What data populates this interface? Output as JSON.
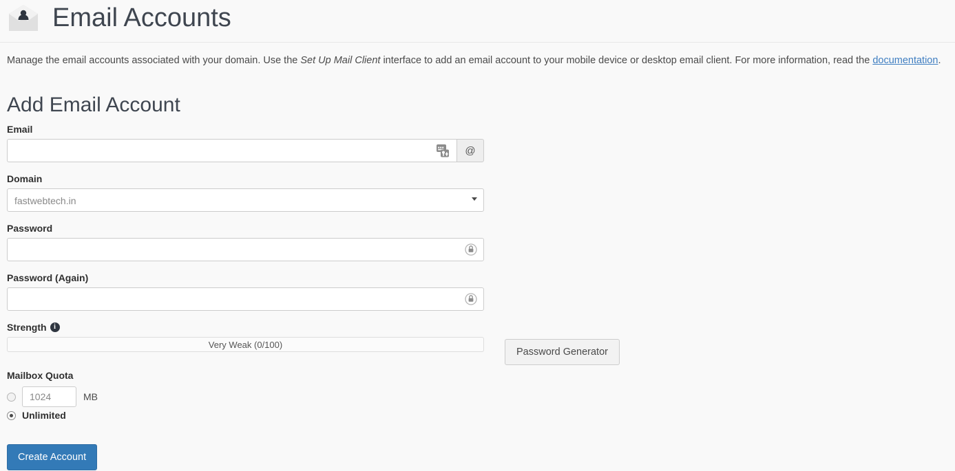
{
  "header": {
    "title": "Email Accounts",
    "icon": "envelope-user-icon"
  },
  "description": {
    "part1": "Manage the email accounts associated with your domain. Use the ",
    "emphasis": "Set Up Mail Client",
    "part2": " interface to add an email account to your mobile device or desktop email client. For more information, read the ",
    "link": "documentation",
    "part3": "."
  },
  "section": {
    "title": "Add Email Account"
  },
  "form": {
    "email": {
      "label": "Email",
      "value": "",
      "placeholder": "",
      "addon": "@",
      "fill_icon": "lastpass-fill-icon"
    },
    "domain": {
      "label": "Domain",
      "selected": "fastwebtech.in",
      "options": [
        "fastwebtech.in"
      ],
      "caret": "chevron-down-icon"
    },
    "password": {
      "label": "Password",
      "value": "",
      "vault_icon": "lastpass-vault-icon"
    },
    "password_again": {
      "label": "Password (Again)",
      "value": "",
      "vault_icon": "lastpass-vault-icon"
    },
    "strength": {
      "label": "Strength",
      "info_icon": "info-icon",
      "bar_text": "Very Weak (0/100)",
      "score": 0,
      "max": 100
    },
    "password_generator": {
      "label": "Password Generator"
    },
    "quota": {
      "label": "Mailbox Quota",
      "size_value": "1024",
      "size_unit": "MB",
      "size_selected": false,
      "unlimited_label": "Unlimited",
      "unlimited_selected": true
    },
    "submit": {
      "label": "Create Account"
    }
  },
  "colors": {
    "primary": "#337ab7",
    "link": "#3f7ec1",
    "page_bg": "#f9f9f9",
    "heading": "#3f4650"
  }
}
